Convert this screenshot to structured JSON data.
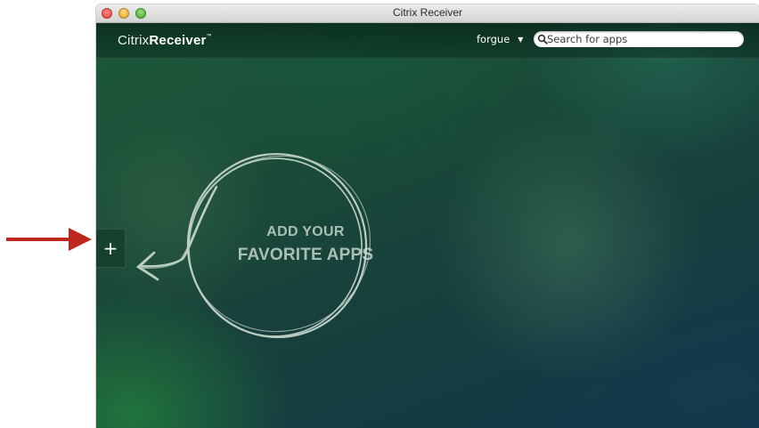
{
  "window": {
    "title": "Citrix Receiver"
  },
  "header": {
    "brand_light": "Citrix",
    "brand_bold": "Receiver",
    "brand_tm": "™",
    "user": "forgue",
    "search_placeholder": "Search for apps"
  },
  "main": {
    "add_button_label": "+",
    "hint_line1": "ADD YOUR",
    "hint_line2": "FAVORITE APPS"
  },
  "colors": {
    "annotation_arrow": "#c0271c",
    "background_green": "#1d5a3a",
    "background_blue": "#14354a",
    "chalk": "#d8e4dc"
  },
  "icons": {
    "close": "close-icon",
    "minimize": "minimize-icon",
    "zoom": "zoom-icon",
    "user_caret": "caret-down-icon",
    "search": "search-icon",
    "add": "plus-icon",
    "annotation": "arrow-right-icon"
  }
}
